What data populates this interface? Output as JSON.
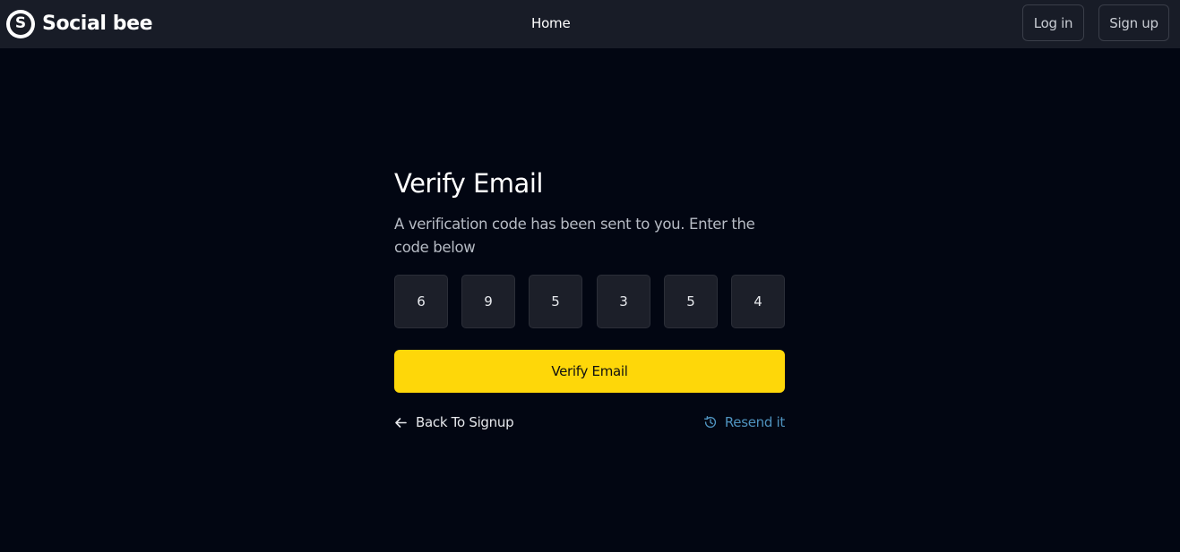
{
  "navbar": {
    "brand_initial": "S",
    "brand_name": "Social bee",
    "home_label": "Home",
    "login_label": "Log in",
    "signup_label": "Sign up"
  },
  "verify": {
    "title": "Verify Email",
    "subtitle": "A verification code has been sent to you. Enter the code below",
    "code_digits": [
      "6",
      "9",
      "5",
      "3",
      "5",
      "4"
    ],
    "submit_label": "Verify Email",
    "back_label": "Back To Signup",
    "resend_label": "Resend it",
    "back_icon": "arrow-left-icon",
    "resend_icon": "history-icon"
  },
  "colors": {
    "background": "#020612",
    "navbar": "#181c27",
    "accent": "#fed709",
    "link": "#4f93bf"
  }
}
